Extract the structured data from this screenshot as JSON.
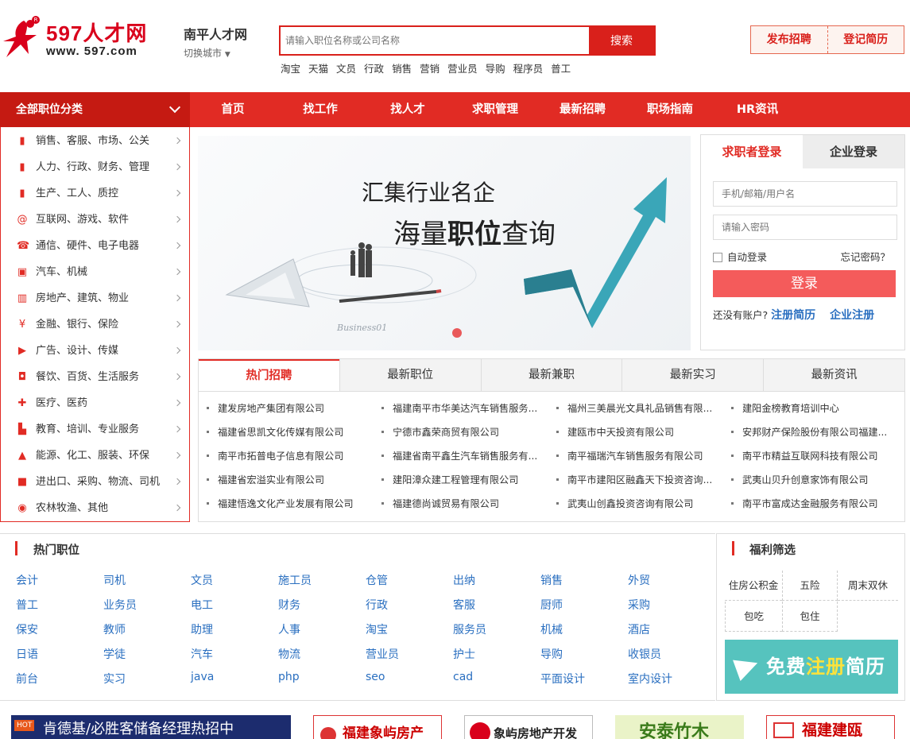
{
  "logo": {
    "main_text": "597人才网",
    "url_text": "www. 597.com"
  },
  "city": {
    "name": "南平人才网",
    "switch": "切换城市"
  },
  "search": {
    "placeholder": "请输入职位名称或公司名称",
    "button": "搜索"
  },
  "hot_words": [
    "淘宝",
    "天猫",
    "文员",
    "行政",
    "销售",
    "营销",
    "营业员",
    "导购",
    "程序员",
    "普工"
  ],
  "header_buttons": {
    "post_job": "发布招聘",
    "register_resume": "登记简历"
  },
  "nav": {
    "all_categories": "全部职位分类",
    "items": [
      "首页",
      "找工作",
      "找人才",
      "求职管理",
      "最新招聘",
      "职场指南",
      "HR资讯"
    ]
  },
  "categories": [
    {
      "icon": "bookmark-icon",
      "label": "销售、客服、市场、公关"
    },
    {
      "icon": "bookmark-icon",
      "label": "人力、行政、财务、管理"
    },
    {
      "icon": "bookmark-icon",
      "label": "生产、工人、质控"
    },
    {
      "icon": "at-icon",
      "label": "互联网、游戏、软件"
    },
    {
      "icon": "phone-icon",
      "label": "通信、硬件、电子电器"
    },
    {
      "icon": "car-icon",
      "label": "汽车、机械"
    },
    {
      "icon": "building-icon",
      "label": "房地产、建筑、物业"
    },
    {
      "icon": "yen-icon",
      "label": "金融、银行、保险"
    },
    {
      "icon": "video-icon",
      "label": "广告、设计、传媒"
    },
    {
      "icon": "bag-icon",
      "label": "餐饮、百货、生活服务"
    },
    {
      "icon": "medical-icon",
      "label": "医疗、医药"
    },
    {
      "icon": "book-icon",
      "label": "教育、培训、专业服务"
    },
    {
      "icon": "flask-icon",
      "label": "能源、化工、服装、环保"
    },
    {
      "icon": "truck-icon",
      "label": "进出口、采购、物流、司机"
    },
    {
      "icon": "globe-icon",
      "label": "农林牧渔、其他"
    }
  ],
  "banner": {
    "line1": "汇集行业名企",
    "line2_pre": "海量",
    "line2_bold": "职位",
    "line2_post": "查询"
  },
  "login": {
    "tab_seeker": "求职者登录",
    "tab_company": "企业登录",
    "username_placeholder": "手机/邮箱/用户名",
    "password_placeholder": "请输入密码",
    "auto_login": "自动登录",
    "forgot": "忘记密码？",
    "button": "登录",
    "no_account": "还没有账户?",
    "register_resume": "注册简历",
    "register_company": "企业注册"
  },
  "job_tabs": [
    "热门招聘",
    "最新职位",
    "最新兼职",
    "最新实习",
    "最新资讯"
  ],
  "companies": [
    [
      "建发房地产集团有限公司",
      "福建南平市华美达汽车销售服务...",
      "福州三美晨光文具礼品销售有限...",
      "建阳金榜教育培训中心"
    ],
    [
      "福建省思凯文化传媒有限公司",
      "宁德市鑫荣商贸有限公司",
      "建瓯市中天投资有限公司",
      "安邦财产保险股份有限公司福建..."
    ],
    [
      "南平市拓普电子信息有限公司",
      "福建省南平鑫生汽车销售服务有...",
      "南平福瑞汽车销售服务有限公司",
      "南平市精益互联网科技有限公司"
    ],
    [
      "福建省宏溢实业有限公司",
      "建阳漳众建工程管理有限公司",
      "南平市建阳区融鑫天下投资咨询...",
      "武夷山贝升创意家饰有限公司"
    ],
    [
      "福建悟逸文化产业发展有限公司",
      "福建德尚诚贸易有限公司",
      "武夷山创鑫投资咨询有限公司",
      "南平市富成达金融服务有限公司"
    ]
  ],
  "hot_positions": {
    "title": "热门职位",
    "rows": [
      [
        "会计",
        "司机",
        "文员",
        "施工员",
        "仓管",
        "出纳",
        "销售",
        "外贸"
      ],
      [
        "普工",
        "业务员",
        "电工",
        "财务",
        "行政",
        "客服",
        "厨师",
        "采购"
      ],
      [
        "保安",
        "教师",
        "助理",
        "人事",
        "淘宝",
        "服务员",
        "机械",
        "酒店"
      ],
      [
        "日语",
        "学徒",
        "汽车",
        "物流",
        "营业员",
        "护士",
        "导购",
        "收银员"
      ],
      [
        "前台",
        "实习",
        "java",
        "php",
        "seo",
        "cad",
        "平面设计",
        "室内设计"
      ]
    ]
  },
  "welfare": {
    "title": "福利筛选",
    "items": [
      "住房公积金",
      "五险",
      "周末双休",
      "包吃",
      "包住"
    ],
    "register_ad_pre": "免费",
    "register_ad_hl": "注册",
    "register_ad_post": "简历"
  },
  "bottom_ads": [
    "肯德基/必胜客储备经理热招中",
    "福建象屿房产",
    "象屿房地产开发",
    "安泰竹木",
    "福建建瓯"
  ]
}
